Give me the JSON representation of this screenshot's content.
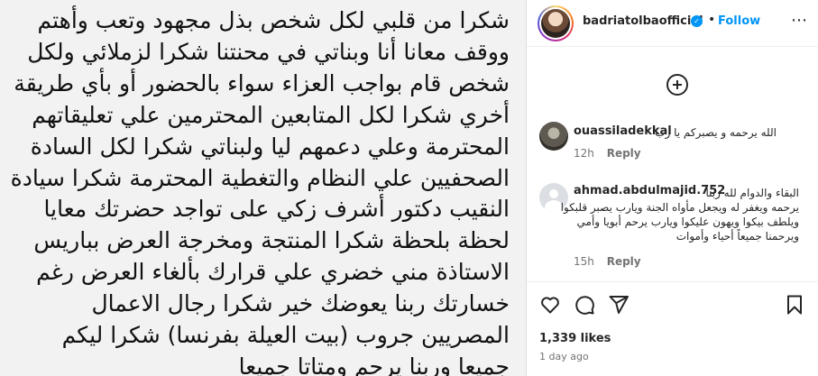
{
  "post": {
    "caption_lines": [
      "شكرا من قلبي لكل شخص بذل مجهود وتعب وأهتم",
      "ووقف معانا أنا وبناتي في محنتنا شكرا لزملائي ولكل",
      "شخص قام بواجب العزاء سواء بالحضور أو بأي طريقة",
      "أخري شكرا لكل المتابعين المحترمين علي تعليقاتهم",
      "المحترمة وعلي دعمهم ليا ولبناتي شكرا لكل السادة",
      "الصحفيين علي النظام والتغطية المحترمة شكرا سيادة",
      "النقيب دكتور أشرف زكي على تواجد حضرتك معايا",
      "لحظة بلحظة شكرا المنتجة ومخرجة العرض بباريس",
      "الاستاذة مني خضري علي قرارك بألغاء العرض رغم",
      "خسارتك ربنا يعوضك خير شكرا رجال الاعمال",
      "المصريين جروب (بيت العيلة بفرنسا) شكرا ليكم",
      "جميعا وربنا يرحم ومتاتا جميعا"
    ]
  },
  "header": {
    "username": "badriatolbaofficial",
    "separator": "•",
    "follow_label": "Follow",
    "more_icon": "⋯"
  },
  "comments": [
    {
      "username": "ouassiladekkal",
      "lines": [
        "الله يرحمه و يصبركم يا رب"
      ],
      "time": "12h",
      "reply_label": "Reply"
    },
    {
      "username": "ahmad.abdulmajid.752",
      "lines": [
        "البقاء والدوام لله ربنا",
        "يرحمه ويغفر له ويجعل مأواه الجنة ويارب يصبر قلبكوا",
        "ويلطف بيكوا ويهون عليكوا ويارب يرحم أبويا وأمي",
        "ويرحمنا جميعاً أحياء وأموات"
      ],
      "time": "15h",
      "reply_label": "Reply"
    }
  ],
  "stats": {
    "likes": "1,339 likes",
    "time_ago": "1 day ago"
  },
  "colors": {
    "accent": "#0095f6",
    "text": "#262626",
    "muted": "#737373"
  }
}
